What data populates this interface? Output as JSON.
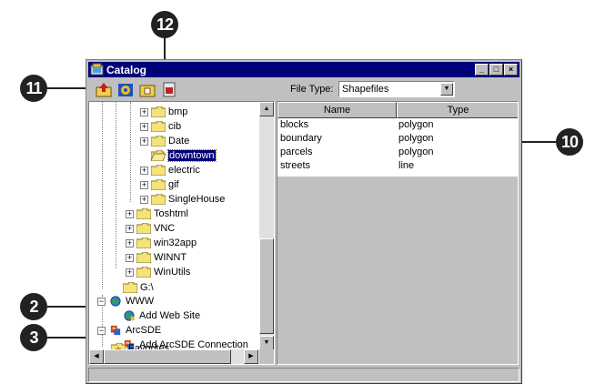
{
  "callouts": {
    "c11": "11",
    "c12": "12",
    "c10": "10",
    "c2": "2",
    "c3": "3"
  },
  "window": {
    "title": "Catalog",
    "buttons": {
      "minimize": "_",
      "maximize": "□",
      "close": "×"
    }
  },
  "toolbar": {
    "tools": [
      "up-one-level-icon",
      "connect-icon",
      "new-folder-icon",
      "delete-icon"
    ],
    "file_type_label": "File Type:",
    "file_type_value": "Shapefiles"
  },
  "tree": {
    "items": [
      {
        "label": "bmp"
      },
      {
        "label": "cib"
      },
      {
        "label": "Date"
      },
      {
        "label": "downtown"
      },
      {
        "label": "electric"
      },
      {
        "label": "gif"
      },
      {
        "label": "SingleHouse"
      },
      {
        "label": "Toshtml"
      },
      {
        "label": "VNC"
      },
      {
        "label": "win32app"
      },
      {
        "label": "WINNT"
      },
      {
        "label": "WinUtils"
      },
      {
        "label": "G:\\"
      },
      {
        "label": "WWW"
      },
      {
        "label": "Add Web Site"
      },
      {
        "label": "ArcSDE"
      },
      {
        "label": "Add ArcSDE Connection"
      },
      {
        "label": "Favorites"
      }
    ]
  },
  "list": {
    "columns": [
      "Name",
      "Type"
    ],
    "rows": [
      {
        "name": "blocks",
        "type": "polygon"
      },
      {
        "name": "boundary",
        "type": "polygon"
      },
      {
        "name": "parcels",
        "type": "polygon"
      },
      {
        "name": "streets",
        "type": "line"
      }
    ]
  },
  "colors": {
    "titlebar": "#00007b",
    "chrome": "#c0c0c0",
    "folder": "#f4e27a",
    "callout": "#222222"
  }
}
